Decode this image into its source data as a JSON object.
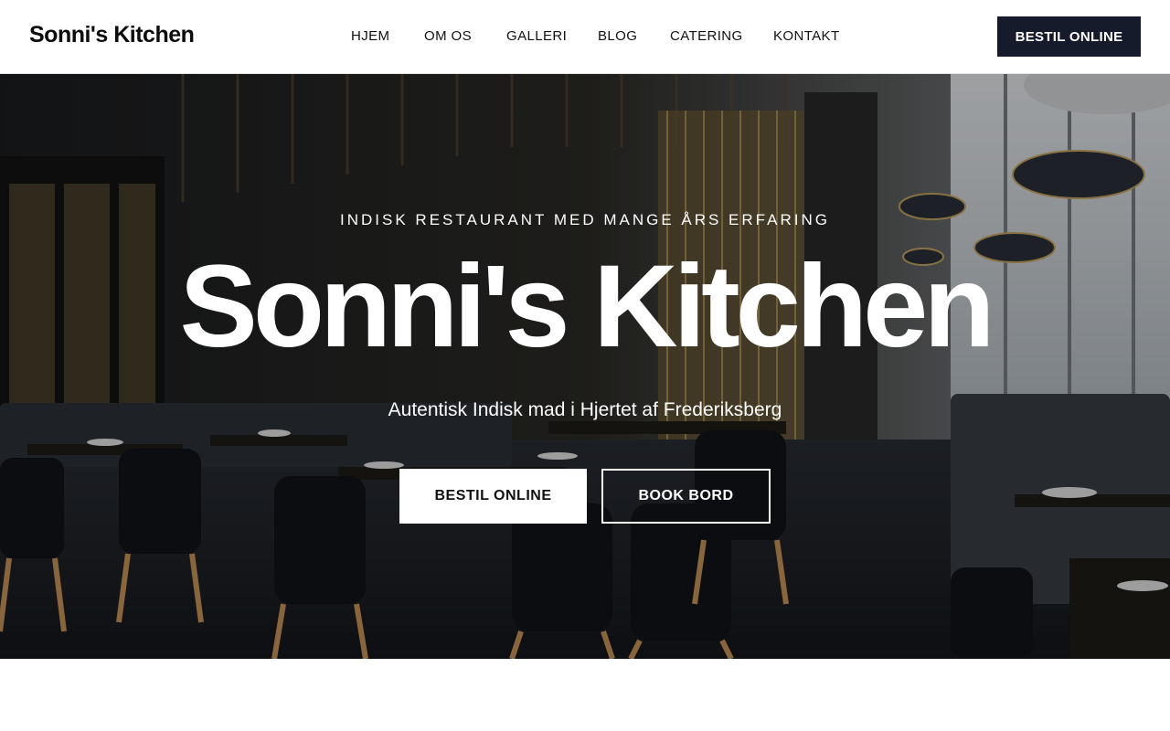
{
  "header": {
    "logo": "Sonni's Kitchen",
    "nav": [
      {
        "label": "HJEM"
      },
      {
        "label": "OM OS"
      },
      {
        "label": "GALLERI"
      },
      {
        "label": "BLOG"
      },
      {
        "label": "CATERING"
      },
      {
        "label": "KONTAKT"
      }
    ],
    "order_button": "BESTIL ONLINE"
  },
  "hero": {
    "eyebrow": "INDISK RESTAURANT MED MANGE ÅRS ERFARING",
    "title": "Sonni's Kitchen",
    "tagline": "Autentisk Indisk mad i Hjertet af Frederiksberg",
    "primary_button": "BESTIL ONLINE",
    "secondary_button": "BOOK BORD",
    "image": "restaurant-interior-photo"
  },
  "colors": {
    "dark_button": "#151b2b",
    "text": "#111111",
    "background": "#ffffff"
  }
}
